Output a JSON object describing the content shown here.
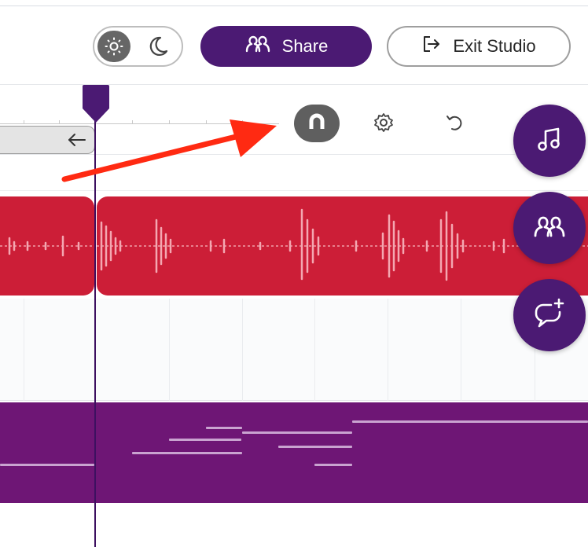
{
  "header": {
    "share_label": "Share",
    "exit_label": "Exit Studio",
    "theme": {
      "active": "light",
      "icons": [
        "sun-icon",
        "moon-icon"
      ]
    }
  },
  "toolbar": {
    "tools": [
      {
        "name": "magnet-snap-icon",
        "active": true
      },
      {
        "name": "gear-icon",
        "active": false
      },
      {
        "name": "undo-icon",
        "active": false
      }
    ],
    "scroll_back_icon": "arrow-left-icon"
  },
  "floating_actions": [
    {
      "icon": "music-note-icon"
    },
    {
      "icon": "collaborators-icon"
    },
    {
      "icon": "add-comment-icon"
    }
  ],
  "colors": {
    "brand_purple": "#4b1a73",
    "audio_track": "#cc1e37",
    "midi_track": "#6e1675",
    "annotation_arrow": "#ff2a12"
  },
  "annotation": {
    "type": "arrow",
    "points_to": "magnet-snap-icon"
  }
}
